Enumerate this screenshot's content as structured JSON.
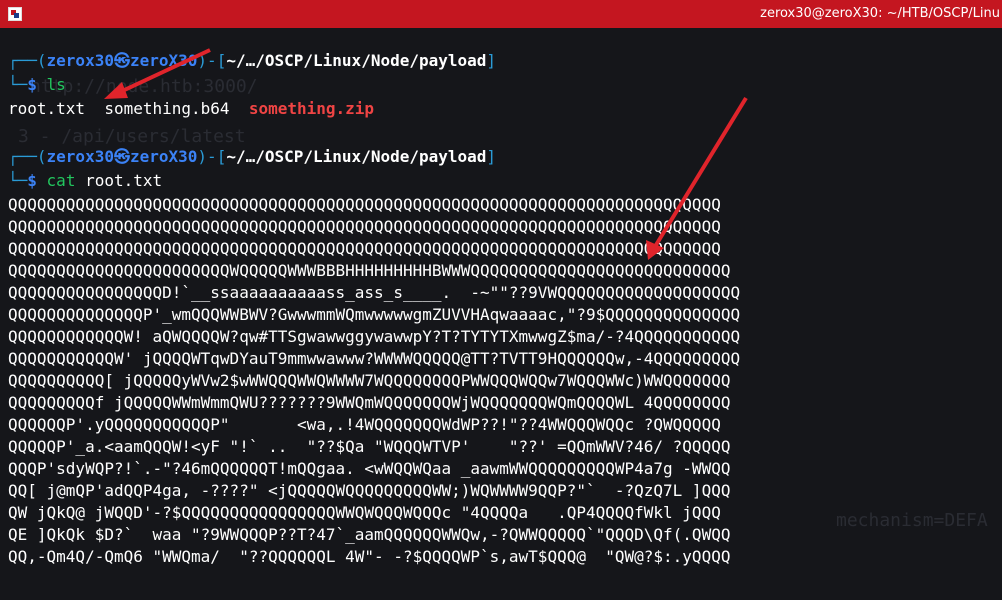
{
  "window": {
    "title": "zerox30@zeroX30: ~/HTB/OSCP/Linu"
  },
  "background_ghost": [
    "http://node.htb:3000/",
    "3 - /api/users/latest",
    "mechanism=DEFA"
  ],
  "prompt": {
    "user": "zerox30",
    "skull": "㉿",
    "host": "zeroX30",
    "path": "~/…/OSCP/Linux/Node/payload",
    "dollar": "$"
  },
  "commands": [
    {
      "name": "ls",
      "arg": ""
    },
    {
      "name": "cat",
      "arg": "root.txt"
    }
  ],
  "ls_output": [
    "root.txt",
    "something.b64",
    "something.zip"
  ],
  "cat_output": [
    "QQQQQQQQQQQQQQQQQQQQQQQQQQQQQQQQQQQQQQQQQQQQQQQQQQQQQQQQQQQQQQQQQQQQQQQQQQ",
    "QQQQQQQQQQQQQQQQQQQQQQQQQQQQQQQQQQQQQQQQQQQQQQQQQQQQQQQQQQQQQQQQQQQQQQQQQQ",
    "QQQQQQQQQQQQQQQQQQQQQQQQQQQQQQQQQQQQQQQQQQQQQQQQQQQQQQQQQQQQQQQQQQQQQQQQQQ",
    "QQQQQQQQQQQQQQQQQQQQQQQWQQQQQWWWBBBHHHHHHHHHBWWWQQQQQQQQQQQQQQQQQQQQQQQQQQQ",
    "QQQQQQQQQQQQQQQQD!`__ssaaaaaaaaaass_ass_s____.  -~\"\"??9VWQQQQQQQQQQQQQQQQQQQ",
    "QQQQQQQQQQQQQQP'_wmQQQWWBWV?GwwwmmWQmwwwwwgmZUVVHAqwaaaac,\"?9$QQQQQQQQQQQQQQ",
    "QQQQQQQQQQQQW! aQWQQQQW?qw#TTSgwawwggywawwpY?T?TYTYTXmwwgZ$ma/-?4QQQQQQQQQQQ",
    "QQQQQQQQQQQW' jQQQQWTqwDYauT9mmwwawww?WWWWQQQQQ@TT?TVTT9HQQQQQQw,-4QQQQQQQQQ",
    "QQQQQQQQQQ[ jQQQQQyWVw2$wWWQQQWWQWWWW7WQQQQQQQQPWWQQQWQQw7WQQQWWc)WWQQQQQQQ",
    "QQQQQQQQQf jQQQQQWWmWmmQWU???????9WWQmWQQQQQQQWjWQQQQQQQWQmQQQQWL 4QQQQQQQQ",
    "QQQQQQP'.yQQQQQQQQQQQP\"       <wa,.!4WQQQQQQQWdWP??!\"??4WWQQQWQQc ?QWQQQQQ",
    "QQQQQP'_a.<aamQQQW!<yF \"!` ..  \"??$Qa \"WQQQWTVP'    \"??' =QQmWWV?46/ ?QQQQQ",
    "QQQP'sdyWQP?!`.-\"?46mQQQQQQT!mQQgaa. <wWQQWQaa _aawmWWQQQQQQQQQWP4a7g -WWQQ",
    "QQ[ j@mQP'adQQP4ga, -????\" <jQQQQQWQQQQQQQQQWW;)WQWWWW9QQP?\"`  -?QzQ7L ]QQQ",
    "QW jQkQ@ jWQQD'-?$QQQQQQQQQQQQQQQQWWQWQQQWQQQc \"4QQQQa   .QP4QQQQfWkl jQQQ",
    "QE ]QkQk $D?`  waa \"?9WWQQQP??T?47`_aamQQQQQQWWQw,-?QWWQQQQQ`\"QQQD\\Qf(.QWQQ",
    "QQ,-Qm4Q/-QmQ6 \"WWQma/  \"??QQQQQQL 4W\"- -?$QQQQWP`s,awT$QQQ@  \"QW@?$:.yQQQQ"
  ],
  "colors": {
    "titlebar": "#c41620",
    "terminal_bg": "#15161a",
    "prompt_frame": "#2a9bd6",
    "prompt_user": "#3b82f6",
    "command": "#22c55e",
    "zip_file": "#ef4444",
    "arrow": "#e0242b"
  },
  "icons": [
    "kali-terminal-icon",
    "skull-icon"
  ]
}
